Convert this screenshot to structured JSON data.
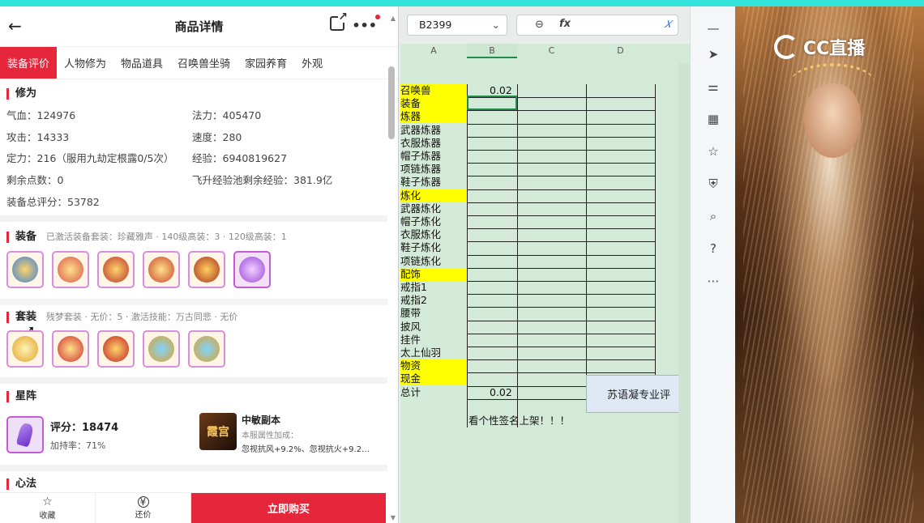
{
  "phone": {
    "header_title": "商品详情",
    "tabs": [
      "装备评价",
      "人物修为",
      "物品道具",
      "召唤兽坐骑",
      "家园养育",
      "外观"
    ],
    "xiuwei": {
      "title": "修为",
      "qixue": "气血：124976",
      "fali": "法力：405470",
      "gongji": "攻击：14333",
      "sudu": "速度：280",
      "dingli": "定力：216（服用九劫定根露0/5次）",
      "jingyan": "经验：6940819627",
      "shengyu": "剩余点数：0",
      "feisheng": "飞升经验池剩余经验：381.9亿",
      "zongpingfen": "装备总评分：53782"
    },
    "zhuangbei": {
      "title": "装备",
      "info": "已激活装备套装：珍藏雅声 · 140级高装：3 · 120级高装：1"
    },
    "taozhuang": {
      "title": "套装",
      "info": "残梦套装 · 无价：5 · 激活技能：万古同悲 · 无价"
    },
    "xingzhen": {
      "title": "星阵",
      "score": "评分：18474",
      "rate": "加持率：71%",
      "dungeon_icon_text": "霞宫",
      "dungeon_title": "中敏副本",
      "dungeon_sub": "本服属性加成：",
      "dungeon_desc": "忽视抗风+9.2%、忽视抗火+9.2…"
    },
    "xinfa": {
      "title": "心法"
    },
    "bottom": {
      "collect": "收藏",
      "bargain": "还价",
      "buy": "立即购买"
    }
  },
  "sheet": {
    "cellref": "B2399",
    "columns": [
      "A",
      "B",
      "C",
      "D"
    ],
    "rows": [
      {
        "a": "召唤兽",
        "b": "0.02",
        "hl": true
      },
      {
        "a": "装备",
        "b": "",
        "hl": true
      },
      {
        "a": "炼器",
        "b": "",
        "hl": true
      },
      {
        "a": "武器炼器",
        "b": "",
        "hl": false
      },
      {
        "a": "衣服炼器",
        "b": "",
        "hl": false
      },
      {
        "a": "帽子炼器",
        "b": "",
        "hl": false
      },
      {
        "a": "项链炼器",
        "b": "",
        "hl": false
      },
      {
        "a": "鞋子炼器",
        "b": "",
        "hl": false
      },
      {
        "a": "炼化",
        "b": "",
        "hl": true
      },
      {
        "a": "武器炼化",
        "b": "",
        "hl": false
      },
      {
        "a": "帽子炼化",
        "b": "",
        "hl": false
      },
      {
        "a": "衣服炼化",
        "b": "",
        "hl": false
      },
      {
        "a": "鞋子炼化",
        "b": "",
        "hl": false
      },
      {
        "a": "项链炼化",
        "b": "",
        "hl": false
      },
      {
        "a": "配饰",
        "b": "",
        "hl": true
      },
      {
        "a": "戒指1",
        "b": "",
        "hl": false
      },
      {
        "a": "戒指2",
        "b": "",
        "hl": false
      },
      {
        "a": "腰带",
        "b": "",
        "hl": false
      },
      {
        "a": "披风",
        "b": "",
        "hl": false
      },
      {
        "a": "挂件",
        "b": "",
        "hl": false
      },
      {
        "a": "太上仙羽",
        "b": "",
        "hl": false
      },
      {
        "a": "物资",
        "b": "",
        "hl": true
      },
      {
        "a": "现金",
        "b": "",
        "hl": true
      },
      {
        "a": "总计",
        "b": "0.02",
        "hl": false
      }
    ],
    "footer_note": "看个性签名上架！！！",
    "side_label": "苏语凝专业评"
  },
  "video": {
    "logo_text": "CC直播"
  }
}
